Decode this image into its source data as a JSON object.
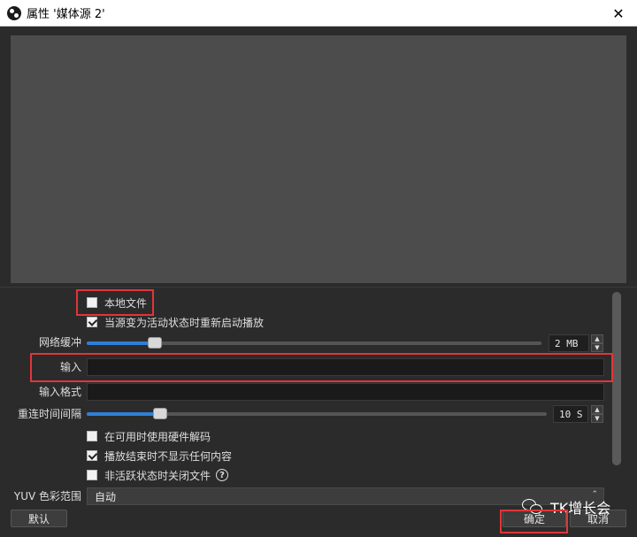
{
  "window": {
    "title": "属性 '媒体源 2'",
    "close_glyph": "✕"
  },
  "options": {
    "local_file": {
      "label": "本地文件",
      "checked": false
    },
    "restart_on_active": {
      "label": "当源变为活动状态时重新启动播放",
      "checked": true
    },
    "network_buffer": {
      "label": "网络缓冲",
      "value": "2 MB",
      "level": 0.15
    },
    "input": {
      "label": "输入",
      "value": ""
    },
    "input_format": {
      "label": "输入格式",
      "value": ""
    },
    "reconnect_delay": {
      "label": "重连时间间隔",
      "value": "10 S",
      "level": 0.16
    },
    "hw_decode": {
      "label": "在可用时使用硬件解码",
      "checked": false
    },
    "hide_on_end": {
      "label": "播放结束时不显示任何内容",
      "checked": true
    },
    "close_when_inactive": {
      "label": "非活跃状态时关闭文件",
      "checked": false,
      "help": "?"
    },
    "yuv_range": {
      "label": "YUV 色彩范围",
      "value": "自动"
    }
  },
  "buttons": {
    "defaults": "默认",
    "ok": "确定",
    "cancel": "取消"
  },
  "spin": {
    "up": "▲",
    "down": "▼",
    "combo_arrow": "⌃"
  },
  "watermark": {
    "text": "TK增长会"
  },
  "colors": {
    "highlight": "#e0363a",
    "slider_accent": "#2f7fd6"
  }
}
